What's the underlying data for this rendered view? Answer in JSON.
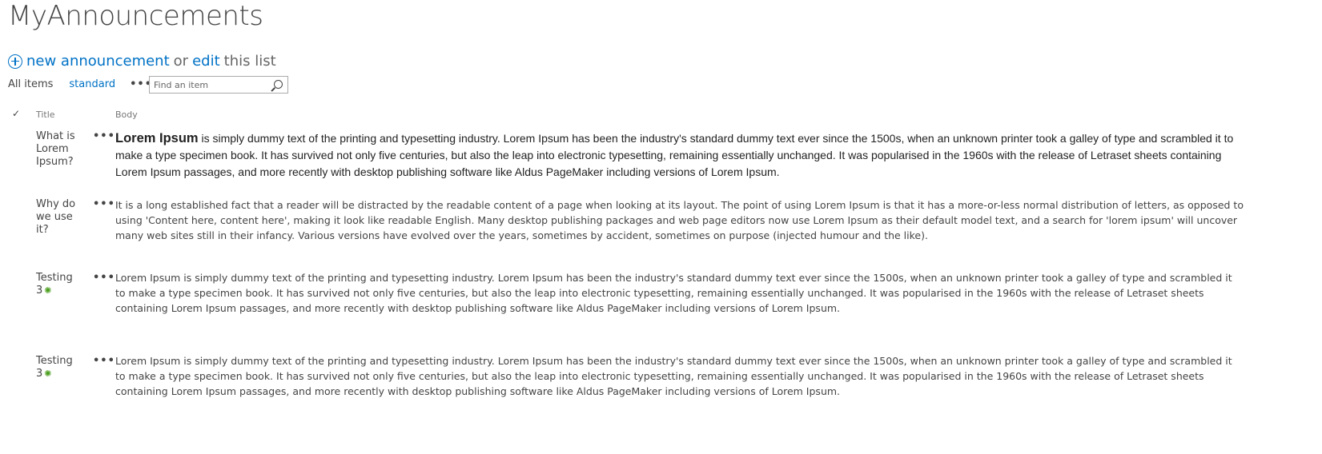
{
  "page": {
    "title": "MyAnnouncements"
  },
  "commands": {
    "new_label": "new announcement",
    "or_label": "or",
    "edit_label": "edit",
    "this_list_label": "this list"
  },
  "views": {
    "all_items": "All items",
    "standard": "standard",
    "more": "•••"
  },
  "search": {
    "placeholder": "Find an item"
  },
  "columns": {
    "check": "✓",
    "title": "Title",
    "body": "Body"
  },
  "rows": [
    {
      "title": "What is Lorem Ipsum?",
      "more": "•••",
      "body_bold": "Lorem Ipsum",
      "body": " is simply dummy text of the printing and typesetting industry. Lorem Ipsum has been the industry's standard dummy text ever since the 1500s, when an unknown printer took a galley of type and scrambled it to make a type specimen book. It has survived not only five centuries, but also the leap into electronic typesetting, remaining essentially unchanged. It was popularised in the 1960s with the release of Letraset sheets containing Lorem Ipsum passages, and more recently with desktop publishing software like Aldus PageMaker including versions of Lorem Ipsum."
    },
    {
      "title": "Why do we use it?",
      "more": "•••",
      "body": "It is a long established fact that a reader will be distracted by the readable content of a page when looking at its layout. The point of using Lorem Ipsum is that it has a more-or-less normal distribution of letters, as opposed to using 'Content here, content here', making it look like readable English. Many desktop publishing packages and web page editors now use Lorem Ipsum as their default model text, and a search for 'lorem ipsum' will uncover many web sites still in their infancy. Various versions have evolved over the years, sometimes by accident, sometimes on purpose (injected humour and the like)."
    },
    {
      "title": "Testing 3",
      "new_icon": "✺",
      "more": "•••",
      "body": "Lorem Ipsum is simply dummy text of the printing and typesetting industry. Lorem Ipsum has been the industry's standard dummy text ever since the 1500s, when an unknown printer took a galley of type and scrambled it to make a type specimen book. It has survived not only five centuries, but also the leap into electronic typesetting, remaining essentially unchanged. It was popularised in the 1960s with the release of Letraset sheets containing Lorem Ipsum passages, and more recently with desktop publishing software like Aldus PageMaker including versions of Lorem Ipsum."
    },
    {
      "title": "Testing 3",
      "new_icon": "✺",
      "more": "•••",
      "body": "Lorem Ipsum is simply dummy text of the printing and typesetting industry. Lorem Ipsum has been the industry's standard dummy text ever since the 1500s, when an unknown printer took a galley of type and scrambled it to make a type specimen book. It has survived not only five centuries, but also the leap into electronic typesetting, remaining essentially unchanged. It was popularised in the 1960s with the release of Letraset sheets containing Lorem Ipsum passages, and more recently with desktop publishing software like Aldus PageMaker including versions of Lorem Ipsum."
    }
  ],
  "colors": {
    "link": "#0072c6",
    "text": "#444444",
    "new_badge": "#4b9e1f"
  }
}
